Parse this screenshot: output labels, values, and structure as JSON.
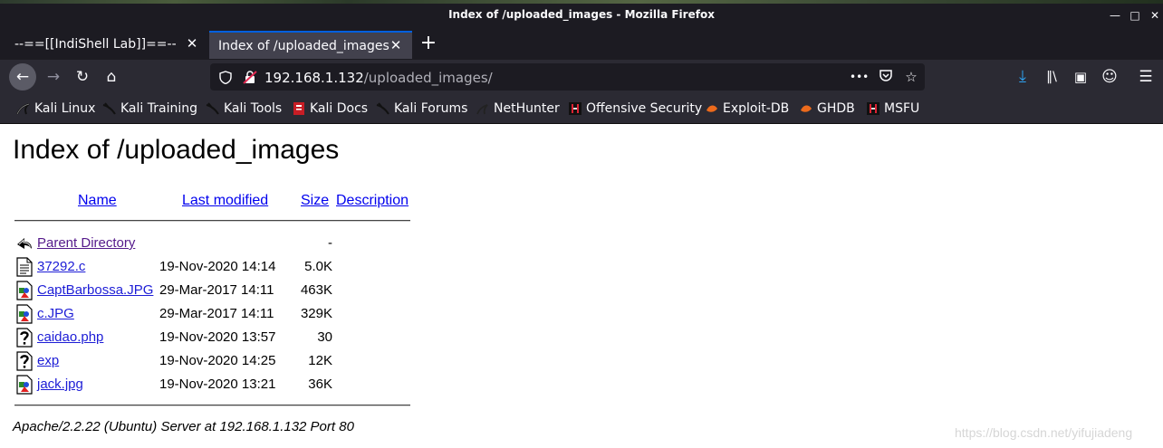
{
  "window": {
    "title": "Index of /uploaded_images - Mozilla Firefox",
    "minimize_glyph": "—",
    "maximize_glyph": "□",
    "close_glyph": "✕"
  },
  "tabs": [
    {
      "label": "--==[[IndiShell Lab]]==--",
      "active": false
    },
    {
      "label": "Index of /uploaded_images",
      "active": true
    }
  ],
  "new_tab_glyph": "+",
  "nav": {
    "back_glyph": "←",
    "forward_glyph": "→",
    "reload_glyph": "↻",
    "home_glyph": "⌂",
    "url_host": "192.168.1.132",
    "url_path": "/uploaded_images/",
    "page_actions_glyph": "•••",
    "download_glyph": "⤓",
    "library_glyph": "‖\\",
    "sidebar_glyph": "▣",
    "account_glyph": "☺",
    "menu_glyph": "☰"
  },
  "bookmarks": [
    {
      "label": "Kali Linux",
      "icon": "kali-dragon-icon"
    },
    {
      "label": "Kali Training",
      "icon": "kali-dragon-icon"
    },
    {
      "label": "Kali Tools",
      "icon": "kali-dragon-icon"
    },
    {
      "label": "Kali Docs",
      "icon": "kali-docs-icon"
    },
    {
      "label": "Kali Forums",
      "icon": "kali-dragon-icon"
    },
    {
      "label": "NetHunter",
      "icon": "nethunter-icon"
    },
    {
      "label": "Offensive Security",
      "icon": "offsec-icon"
    },
    {
      "label": "Exploit-DB",
      "icon": "exploit-db-icon"
    },
    {
      "label": "GHDB",
      "icon": "ghdb-icon"
    },
    {
      "label": "MSFU",
      "icon": "offsec-icon"
    }
  ],
  "page": {
    "title": "Index of /uploaded_images",
    "columns": {
      "name": "Name",
      "last_modified": "Last modified",
      "size": "Size",
      "description": "Description"
    },
    "parent": {
      "name": "Parent Directory",
      "date": "",
      "size": "-",
      "icon": "back-arrow-icon"
    },
    "files": [
      {
        "name": "37292.c",
        "date": "19-Nov-2020 14:14",
        "size": "5.0K",
        "icon": "text-file-icon"
      },
      {
        "name": "CaptBarbossa.JPG",
        "date": "29-Mar-2017 14:11",
        "size": "463K",
        "icon": "image-file-icon"
      },
      {
        "name": "c.JPG",
        "date": "29-Mar-2017 14:11",
        "size": "329K",
        "icon": "image-file-icon"
      },
      {
        "name": "caidao.php",
        "date": "19-Nov-2020 13:57",
        "size": "30",
        "icon": "unknown-file-icon"
      },
      {
        "name": "exp",
        "date": "19-Nov-2020 14:25",
        "size": "12K",
        "icon": "unknown-file-icon"
      },
      {
        "name": "jack.jpg",
        "date": "19-Nov-2020 13:21",
        "size": "36K",
        "icon": "image-file-icon"
      }
    ],
    "address": "Apache/2.2.22 (Ubuntu) Server at 192.168.1.132 Port 80"
  },
  "watermark": "https://blog.csdn.net/yifujiadeng",
  "colors": {
    "titlebar": "#1c1b22",
    "toolbar": "#2b2a33",
    "active_tab": "#42414d",
    "link": "#1d1dd6",
    "visited_link": "#551a8b",
    "download_accent": "#2ea3f2"
  }
}
